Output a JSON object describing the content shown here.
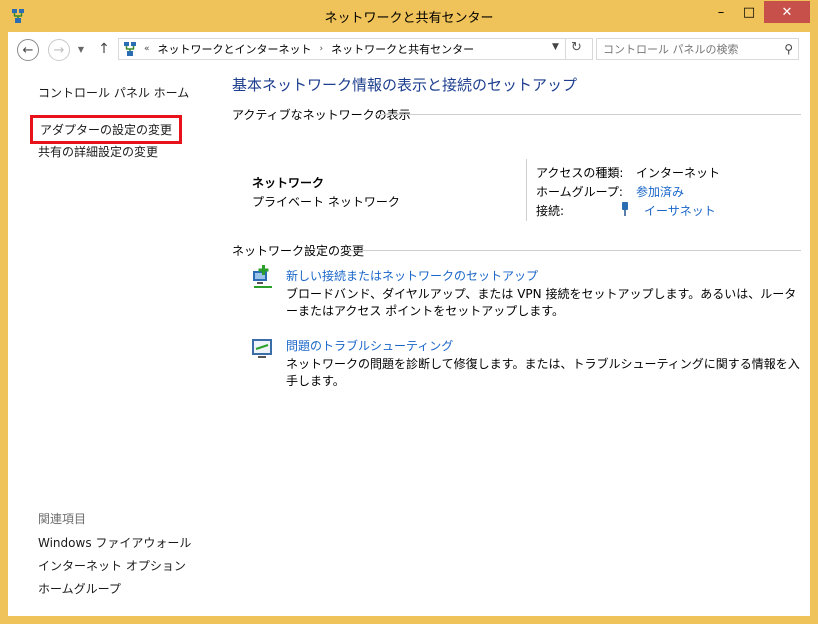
{
  "window": {
    "title": "ネットワークと共有センター",
    "icon": "network-icon",
    "controls": {
      "minimize": "–",
      "maximize": "□",
      "close": "✕"
    }
  },
  "nav": {
    "back_icon": "back-arrow-icon",
    "forward_icon": "forward-arrow-icon",
    "up_icon": "up-arrow-icon",
    "address": {
      "prefix": "«",
      "segments": [
        "ネットワークとインターネット",
        "ネットワークと共有センター"
      ],
      "separator": "›"
    },
    "search": {
      "placeholder": "コントロール パネルの検索"
    }
  },
  "left_panel": {
    "home": "コントロール パネル ホーム",
    "adapter_settings": "アダプターの設定の変更",
    "advanced_sharing": "共有の詳細設定の変更",
    "related_heading": "関連項目",
    "related": [
      "Windows ファイアウォール",
      "インターネット オプション",
      "ホームグループ"
    ],
    "highlight_color": "#e8121a"
  },
  "main": {
    "title": "基本ネットワーク情報の表示と接続のセットアップ",
    "active_heading": "アクティブなネットワークの表示",
    "network": {
      "name": "ネットワーク",
      "type": "プライベート ネットワーク",
      "props": [
        {
          "label": "アクセスの種類:",
          "value": "インターネット"
        },
        {
          "label": "ホームグループ:",
          "value": "参加済み"
        },
        {
          "label": "接続:",
          "value": "イーサネット"
        }
      ]
    },
    "settings_heading": "ネットワーク設定の変更",
    "tasks": [
      {
        "link": "新しい接続またはネットワークのセットアップ",
        "desc": "ブロードバンド、ダイヤルアップ、または VPN 接続をセットアップします。あるいは、ルーターまたはアクセス ポイントをセットアップします。"
      },
      {
        "link": "問題のトラブルシューティング",
        "desc": "ネットワークの問題を診断して修復します。または、トラブルシューティングに関する情報を入手します。"
      }
    ]
  },
  "colors": {
    "frame": "#f0c35a",
    "title_blue": "#1e3f8f",
    "link_blue": "#1a66c8",
    "close_red": "#c7504b"
  }
}
